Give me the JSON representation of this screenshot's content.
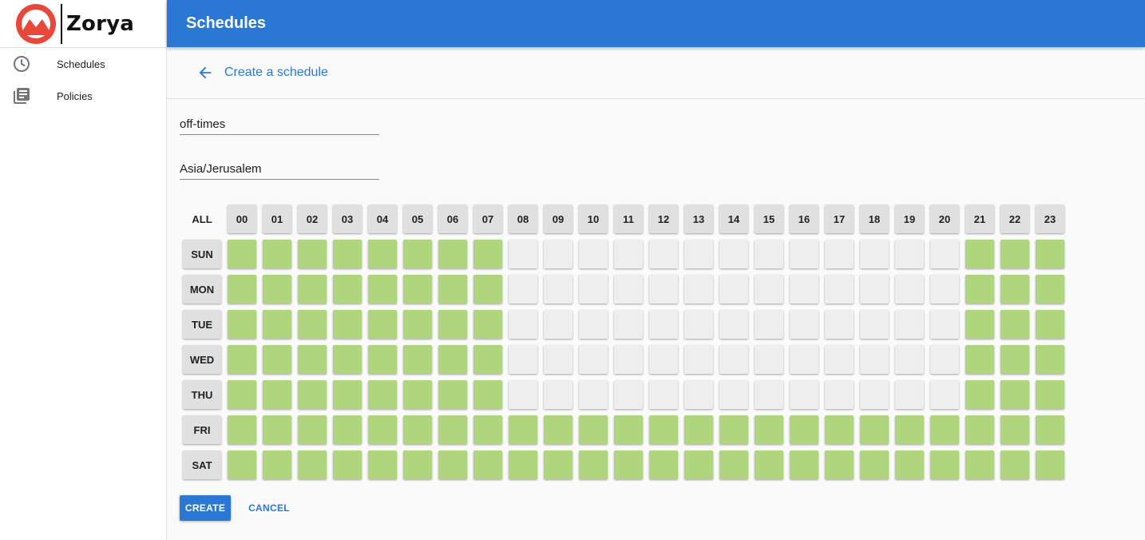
{
  "brand": {
    "name": "Zorya",
    "logo_color": "#e8473a"
  },
  "sidebar": {
    "items": [
      {
        "label": "Schedules",
        "icon": "clock-icon"
      },
      {
        "label": "Policies",
        "icon": "library-books-icon"
      }
    ]
  },
  "header": {
    "title": "Schedules",
    "color": "#2b78d4"
  },
  "subheader": {
    "title": "Create a schedule",
    "back_icon": "arrow-back-icon"
  },
  "form": {
    "name_value": "off-times",
    "timezone_value": "Asia/Jerusalem"
  },
  "grid": {
    "all_label": "ALL",
    "hours": [
      "00",
      "01",
      "02",
      "03",
      "04",
      "05",
      "06",
      "07",
      "08",
      "09",
      "10",
      "11",
      "12",
      "13",
      "14",
      "15",
      "16",
      "17",
      "18",
      "19",
      "20",
      "21",
      "22",
      "23"
    ],
    "days": [
      {
        "label": "SUN",
        "on": [
          1,
          1,
          1,
          1,
          1,
          1,
          1,
          1,
          0,
          0,
          0,
          0,
          0,
          0,
          0,
          0,
          0,
          0,
          0,
          0,
          0,
          1,
          1,
          1
        ]
      },
      {
        "label": "MON",
        "on": [
          1,
          1,
          1,
          1,
          1,
          1,
          1,
          1,
          0,
          0,
          0,
          0,
          0,
          0,
          0,
          0,
          0,
          0,
          0,
          0,
          0,
          1,
          1,
          1
        ]
      },
      {
        "label": "TUE",
        "on": [
          1,
          1,
          1,
          1,
          1,
          1,
          1,
          1,
          0,
          0,
          0,
          0,
          0,
          0,
          0,
          0,
          0,
          0,
          0,
          0,
          0,
          1,
          1,
          1
        ]
      },
      {
        "label": "WED",
        "on": [
          1,
          1,
          1,
          1,
          1,
          1,
          1,
          1,
          0,
          0,
          0,
          0,
          0,
          0,
          0,
          0,
          0,
          0,
          0,
          0,
          0,
          1,
          1,
          1
        ]
      },
      {
        "label": "THU",
        "on": [
          1,
          1,
          1,
          1,
          1,
          1,
          1,
          1,
          0,
          0,
          0,
          0,
          0,
          0,
          0,
          0,
          0,
          0,
          0,
          0,
          0,
          1,
          1,
          1
        ]
      },
      {
        "label": "FRI",
        "on": [
          1,
          1,
          1,
          1,
          1,
          1,
          1,
          1,
          1,
          1,
          1,
          1,
          1,
          1,
          1,
          1,
          1,
          1,
          1,
          1,
          1,
          1,
          1,
          1
        ]
      },
      {
        "label": "SAT",
        "on": [
          1,
          1,
          1,
          1,
          1,
          1,
          1,
          1,
          1,
          1,
          1,
          1,
          1,
          1,
          1,
          1,
          1,
          1,
          1,
          1,
          1,
          1,
          1,
          1
        ]
      }
    ],
    "on_color": "#afd57e",
    "off_color": "#eeeeee"
  },
  "actions": {
    "create_label": "CREATE",
    "cancel_label": "CANCEL"
  }
}
